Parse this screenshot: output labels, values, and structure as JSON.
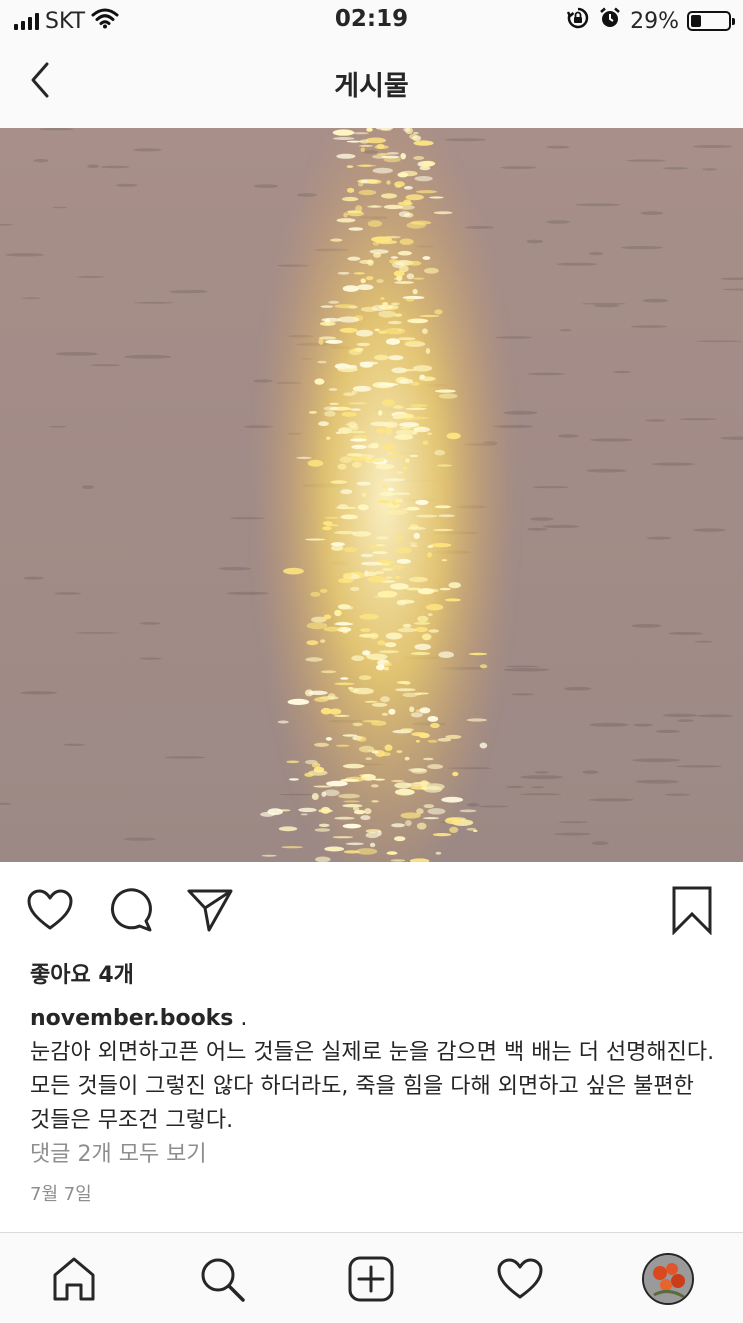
{
  "status_bar": {
    "carrier": "SKT",
    "time": "02:19",
    "battery_percent": "29%",
    "battery_level": 0.29,
    "icons": [
      "signal-icon",
      "wifi-icon",
      "rotation-lock-icon",
      "alarm-icon",
      "battery-icon"
    ]
  },
  "nav": {
    "title": "게시물",
    "back_icon": "chevron-left-icon"
  },
  "post": {
    "image_description_icon": "photo",
    "likes": "좋아요 4개",
    "username": "november.books",
    "username_suffix": " .",
    "caption": "눈감아 외면하고픈 어느 것들은 실제로 눈을 감으면 백 배는 더 선명해진다. 모든 것들이 그렇진 않다 하더라도, 죽을 힘을 다해 외면하고 싶은 불편한 것들은 무조건 그렇다.",
    "comments_link": "댓글 2개 모두 보기",
    "date": "7월 7일"
  },
  "actions": [
    "heart-icon",
    "comment-icon",
    "share-icon",
    "bookmark-icon"
  ],
  "tab_bar": [
    "home-icon",
    "search-icon",
    "add-post-icon",
    "activity-heart-icon",
    "profile-avatar"
  ],
  "colors": {
    "text": "#262626",
    "muted": "#8e8e8e",
    "bar_bg": "#fafafa",
    "divider": "#dbdbdb"
  }
}
